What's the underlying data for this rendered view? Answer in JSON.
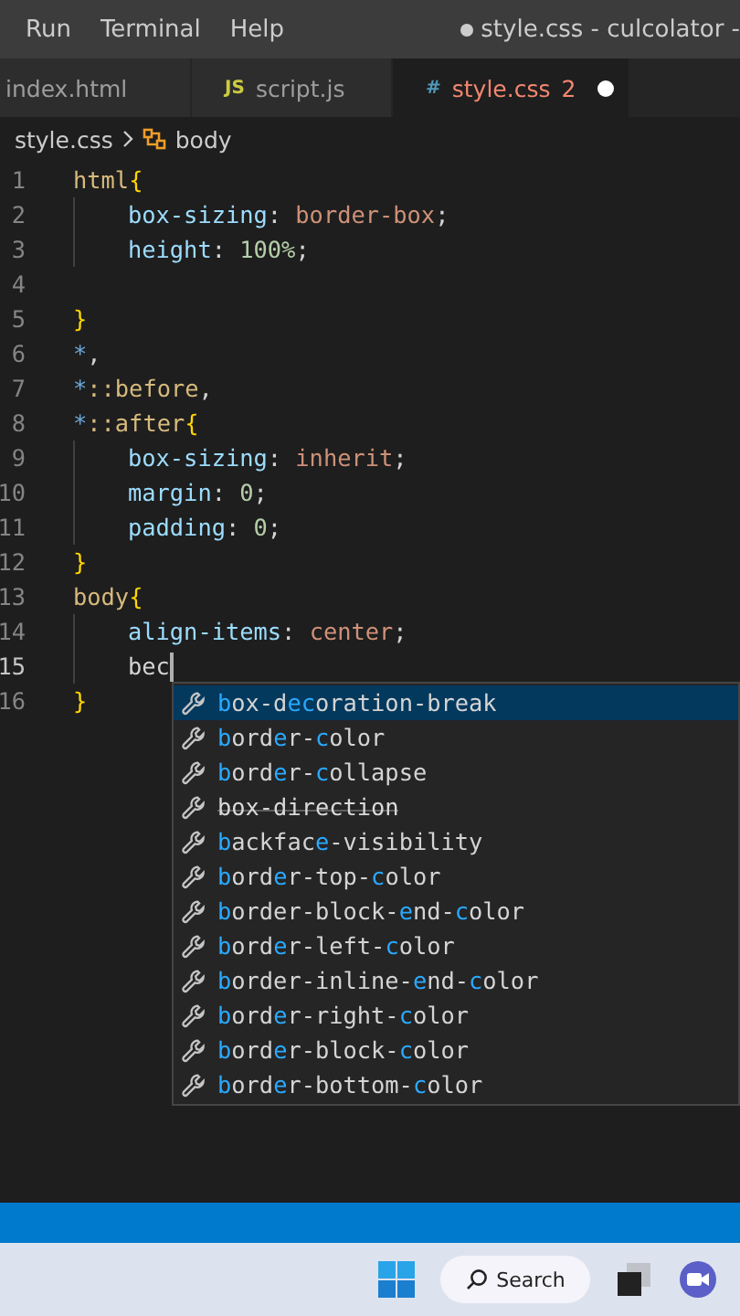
{
  "menu": [
    "Run",
    "Terminal",
    "Help"
  ],
  "window": {
    "title": "style.css - culcolator -",
    "modified": true
  },
  "tabs": [
    {
      "label": "index.html",
      "selected": false,
      "modified": false
    },
    {
      "label": "script.js",
      "icon": "JS",
      "selected": false,
      "modified": false
    },
    {
      "label": "style.css",
      "icon": "#",
      "selected": true,
      "modified": true,
      "problems": "2"
    }
  ],
  "breadcrumb": [
    "style.css",
    "body"
  ],
  "code": [
    {
      "number": "1",
      "indented": false,
      "cursor": false,
      "tokens": [
        {
          "kind": "selector",
          "text": "html"
        },
        {
          "kind": "brace",
          "text": "{"
        }
      ]
    },
    {
      "number": "2",
      "indented": true,
      "cursor": false,
      "tokens": [
        {
          "kind": "property",
          "text": "box-sizing"
        },
        {
          "kind": "punct",
          "text": ": "
        },
        {
          "kind": "value",
          "text": "border-box"
        },
        {
          "kind": "punct",
          "text": ";"
        }
      ]
    },
    {
      "number": "3",
      "indented": true,
      "cursor": false,
      "tokens": [
        {
          "kind": "property",
          "text": "height"
        },
        {
          "kind": "punct",
          "text": ": "
        },
        {
          "kind": "number",
          "text": "100%"
        },
        {
          "kind": "punct",
          "text": ";"
        }
      ]
    },
    {
      "number": "4",
      "indented": false,
      "cursor": false
    },
    {
      "number": "5",
      "indented": false,
      "cursor": false,
      "tokens": [
        {
          "kind": "brace",
          "text": "}"
        }
      ]
    },
    {
      "number": "6",
      "indented": false,
      "cursor": false,
      "tokens": [
        {
          "kind": "star",
          "text": "*"
        },
        {
          "kind": "punct",
          "text": ","
        }
      ]
    },
    {
      "number": "7",
      "indented": false,
      "cursor": false,
      "tokens": [
        {
          "kind": "star",
          "text": "*"
        },
        {
          "kind": "selector",
          "text": "::before"
        },
        {
          "kind": "punct",
          "text": ","
        }
      ]
    },
    {
      "number": "8",
      "indented": false,
      "cursor": false,
      "tokens": [
        {
          "kind": "star",
          "text": "*"
        },
        {
          "kind": "selector",
          "text": "::after"
        },
        {
          "kind": "brace",
          "text": "{"
        }
      ]
    },
    {
      "number": "9",
      "indented": true,
      "cursor": false,
      "tokens": [
        {
          "kind": "property",
          "text": "box-sizing"
        },
        {
          "kind": "punct",
          "text": ": "
        },
        {
          "kind": "value",
          "text": "inherit"
        },
        {
          "kind": "punct",
          "text": ";"
        }
      ]
    },
    {
      "number": "10",
      "indented": true,
      "cursor": false,
      "tokens": [
        {
          "kind": "property",
          "text": "margin"
        },
        {
          "kind": "punct",
          "text": ": "
        },
        {
          "kind": "number",
          "text": "0"
        },
        {
          "kind": "punct",
          "text": ";"
        }
      ]
    },
    {
      "number": "11",
      "indented": true,
      "cursor": false,
      "tokens": [
        {
          "kind": "property",
          "text": "padding"
        },
        {
          "kind": "punct",
          "text": ": "
        },
        {
          "kind": "number",
          "text": "0"
        },
        {
          "kind": "punct",
          "text": ";"
        }
      ]
    },
    {
      "number": "12",
      "indented": false,
      "cursor": false,
      "tokens": [
        {
          "kind": "brace",
          "text": "}"
        }
      ]
    },
    {
      "number": "13",
      "indented": false,
      "cursor": false,
      "tokens": [
        {
          "kind": "selector",
          "text": "body"
        },
        {
          "kind": "brace",
          "text": "{"
        }
      ]
    },
    {
      "number": "14",
      "indented": true,
      "cursor": false,
      "tokens": [
        {
          "kind": "property",
          "text": "align-items"
        },
        {
          "kind": "punct",
          "text": ": "
        },
        {
          "kind": "value",
          "text": "center"
        },
        {
          "kind": "punct",
          "text": ";"
        }
      ]
    },
    {
      "number": "15",
      "indented": true,
      "cursor": true,
      "tokens": [
        {
          "kind": "punct",
          "text": "bec"
        }
      ]
    },
    {
      "number": "16",
      "indented": false,
      "cursor": false,
      "tokens": [
        {
          "kind": "brace",
          "text": "}"
        }
      ]
    }
  ],
  "suggestions": [
    {
      "selected": true,
      "deprecated": false,
      "parts": [
        {
          "t": "b",
          "m": true
        },
        {
          "t": "ox-d",
          "m": false
        },
        {
          "t": "ec",
          "m": true
        },
        {
          "t": "oration-break",
          "m": false
        }
      ]
    },
    {
      "selected": false,
      "deprecated": false,
      "parts": [
        {
          "t": "b",
          "m": true
        },
        {
          "t": "ord",
          "m": false
        },
        {
          "t": "e",
          "m": true
        },
        {
          "t": "r-",
          "m": false
        },
        {
          "t": "c",
          "m": true
        },
        {
          "t": "olor",
          "m": false
        }
      ]
    },
    {
      "selected": false,
      "deprecated": false,
      "parts": [
        {
          "t": "b",
          "m": true
        },
        {
          "t": "ord",
          "m": false
        },
        {
          "t": "e",
          "m": true
        },
        {
          "t": "r-",
          "m": false
        },
        {
          "t": "c",
          "m": true
        },
        {
          "t": "ollapse",
          "m": false
        }
      ]
    },
    {
      "selected": false,
      "deprecated": true,
      "parts": [
        {
          "t": "box-direction",
          "m": false
        }
      ]
    },
    {
      "selected": false,
      "deprecated": false,
      "parts": [
        {
          "t": "b",
          "m": true
        },
        {
          "t": "ackfac",
          "m": false
        },
        {
          "t": "e",
          "m": true
        },
        {
          "t": "-visibility",
          "m": false
        }
      ]
    },
    {
      "selected": false,
      "deprecated": false,
      "parts": [
        {
          "t": "b",
          "m": true
        },
        {
          "t": "ord",
          "m": false
        },
        {
          "t": "e",
          "m": true
        },
        {
          "t": "r-top-",
          "m": false
        },
        {
          "t": "c",
          "m": true
        },
        {
          "t": "olor",
          "m": false
        }
      ]
    },
    {
      "selected": false,
      "deprecated": false,
      "parts": [
        {
          "t": "b",
          "m": true
        },
        {
          "t": "order-block-",
          "m": false
        },
        {
          "t": "e",
          "m": true
        },
        {
          "t": "nd-",
          "m": false
        },
        {
          "t": "c",
          "m": true
        },
        {
          "t": "olor",
          "m": false
        }
      ]
    },
    {
      "selected": false,
      "deprecated": false,
      "parts": [
        {
          "t": "b",
          "m": true
        },
        {
          "t": "ord",
          "m": false
        },
        {
          "t": "e",
          "m": true
        },
        {
          "t": "r-left-",
          "m": false
        },
        {
          "t": "c",
          "m": true
        },
        {
          "t": "olor",
          "m": false
        }
      ]
    },
    {
      "selected": false,
      "deprecated": false,
      "parts": [
        {
          "t": "b",
          "m": true
        },
        {
          "t": "order-inline-",
          "m": false
        },
        {
          "t": "e",
          "m": true
        },
        {
          "t": "nd-",
          "m": false
        },
        {
          "t": "c",
          "m": true
        },
        {
          "t": "olor",
          "m": false
        }
      ]
    },
    {
      "selected": false,
      "deprecated": false,
      "parts": [
        {
          "t": "b",
          "m": true
        },
        {
          "t": "ord",
          "m": false
        },
        {
          "t": "e",
          "m": true
        },
        {
          "t": "r-right-",
          "m": false
        },
        {
          "t": "c",
          "m": true
        },
        {
          "t": "olor",
          "m": false
        }
      ]
    },
    {
      "selected": false,
      "deprecated": false,
      "parts": [
        {
          "t": "b",
          "m": true
        },
        {
          "t": "ord",
          "m": false
        },
        {
          "t": "e",
          "m": true
        },
        {
          "t": "r-block-",
          "m": false
        },
        {
          "t": "c",
          "m": true
        },
        {
          "t": "olor",
          "m": false
        }
      ]
    },
    {
      "selected": false,
      "deprecated": false,
      "parts": [
        {
          "t": "b",
          "m": true
        },
        {
          "t": "ord",
          "m": false
        },
        {
          "t": "e",
          "m": true
        },
        {
          "t": "r-bottom-",
          "m": false
        },
        {
          "t": "c",
          "m": true
        },
        {
          "t": "olor",
          "m": false
        }
      ]
    }
  ],
  "taskbar": {
    "search_label": "Search"
  }
}
